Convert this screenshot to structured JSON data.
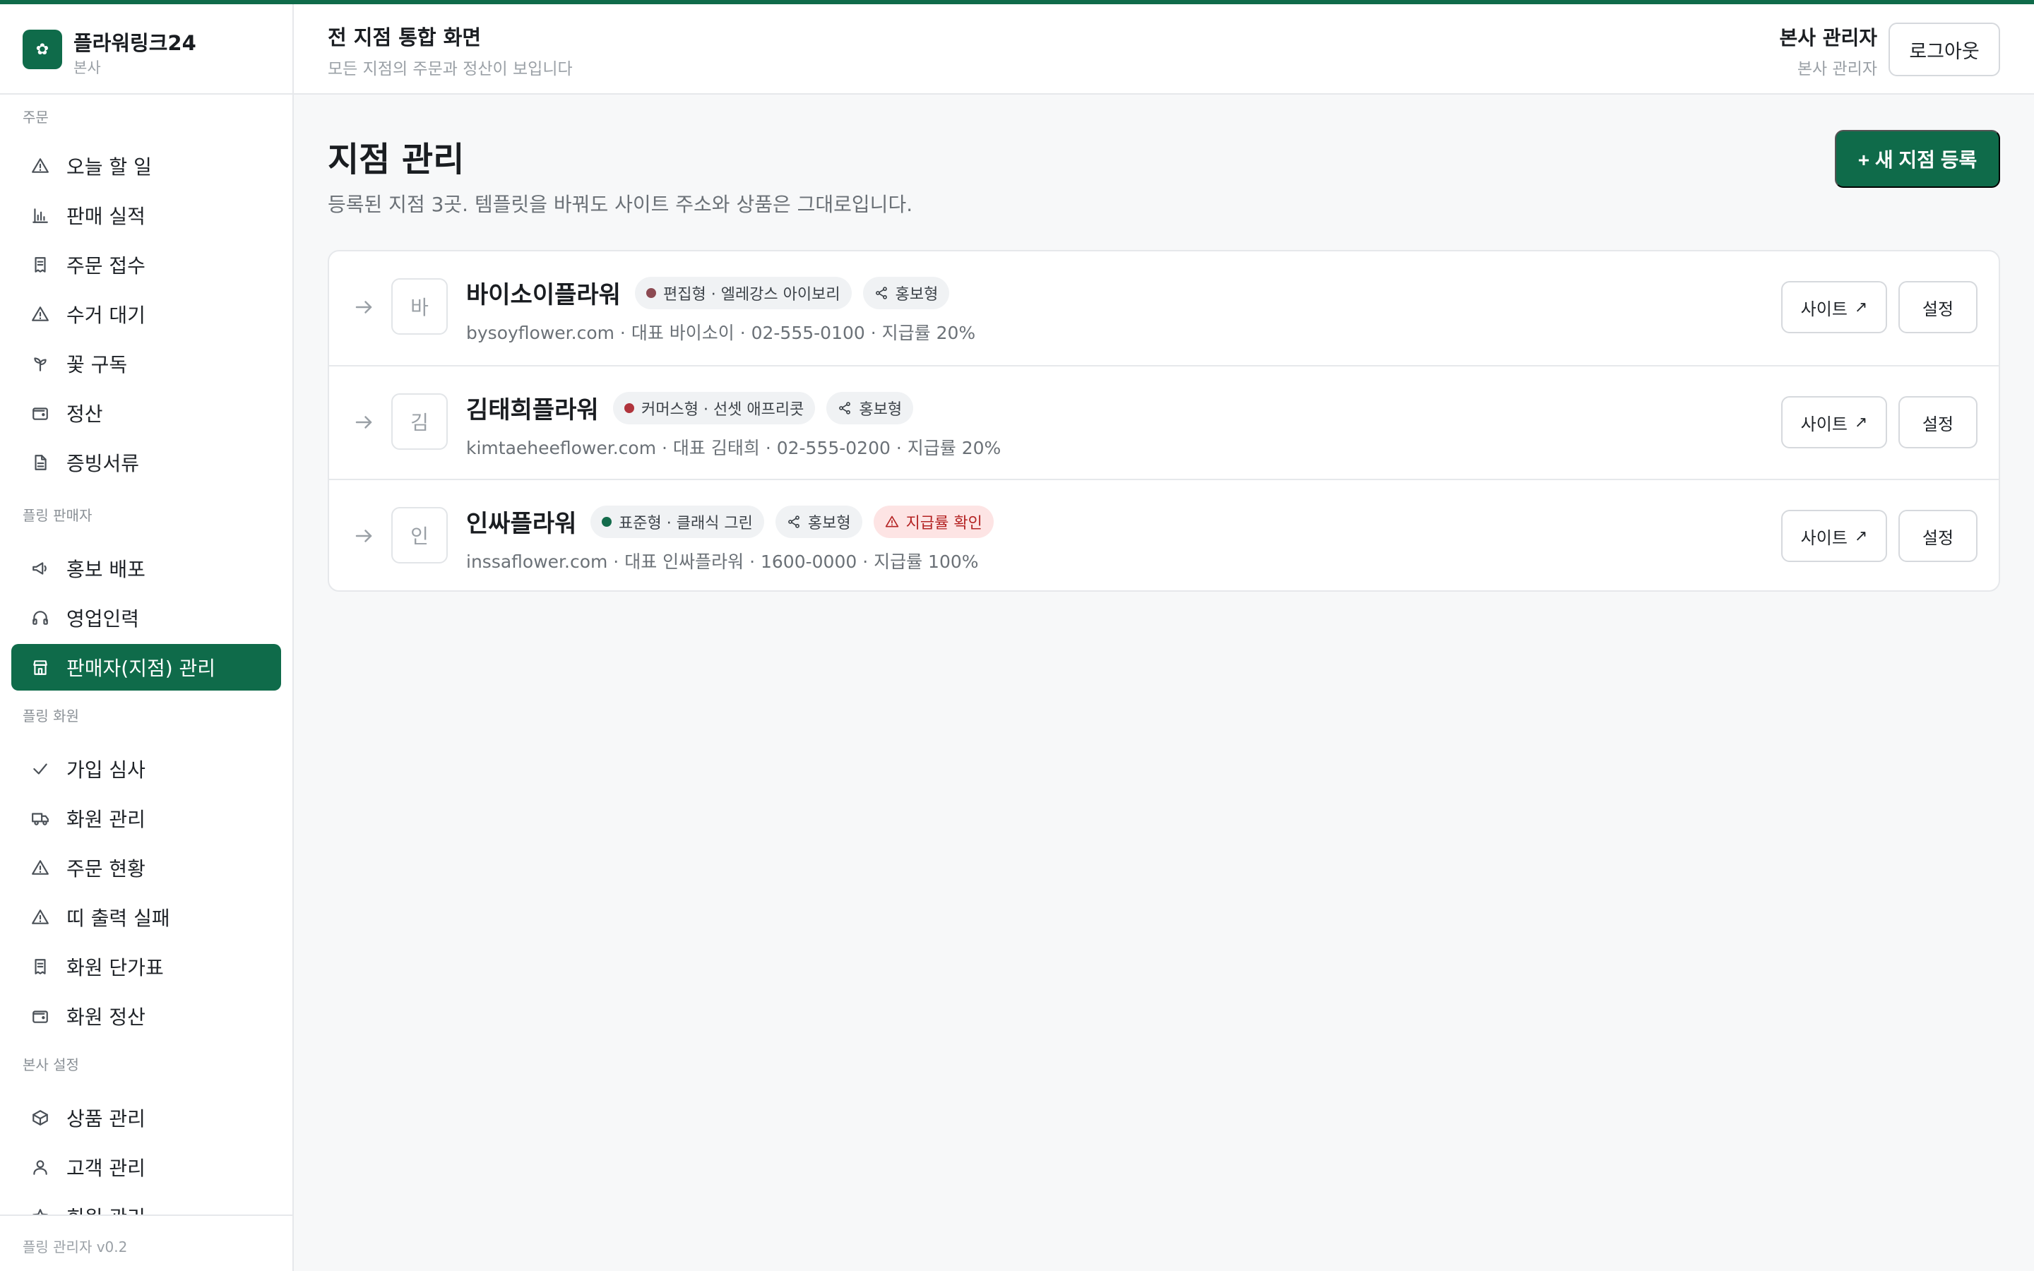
{
  "brand": {
    "name": "플라워링크24",
    "sub": "본사",
    "logo_icon": "flower-icon"
  },
  "header": {
    "title": "전 지점 통합 화면",
    "subtitle": "모든 지점의 주문과 정산이 보입니다",
    "user_name": "본사 관리자",
    "user_role": "본사 관리자",
    "logout_label": "로그아웃"
  },
  "sidebar": {
    "sections": [
      {
        "title": "주문",
        "items": [
          {
            "label": "오늘 할 일",
            "icon": "alert-triangle-icon"
          },
          {
            "label": "판매 실적",
            "icon": "bar-chart-icon"
          },
          {
            "label": "주문 접수",
            "icon": "receipt-icon"
          },
          {
            "label": "수거 대기",
            "icon": "alert-triangle-icon"
          },
          {
            "label": "꽃 구독",
            "icon": "sprout-icon"
          },
          {
            "label": "정산",
            "icon": "wallet-icon"
          },
          {
            "label": "증빙서류",
            "icon": "document-icon"
          }
        ]
      },
      {
        "title": "플링 판매자",
        "items": [
          {
            "label": "홍보 배포",
            "icon": "megaphone-icon"
          },
          {
            "label": "영업인력",
            "icon": "headphones-icon"
          },
          {
            "label": "판매자(지점) 관리",
            "icon": "store-icon",
            "active": true
          }
        ]
      },
      {
        "title": "플링 화원",
        "items": [
          {
            "label": "가입 심사",
            "icon": "check-icon"
          },
          {
            "label": "화원 관리",
            "icon": "truck-icon"
          },
          {
            "label": "주문 현황",
            "icon": "alert-triangle-icon"
          },
          {
            "label": "띠 출력 실패",
            "icon": "alert-triangle-icon"
          },
          {
            "label": "화원 단가표",
            "icon": "receipt-icon"
          },
          {
            "label": "화원 정산",
            "icon": "wallet-icon"
          }
        ]
      },
      {
        "title": "본사 설정",
        "items": [
          {
            "label": "상품 관리",
            "icon": "box-icon"
          },
          {
            "label": "고객 관리",
            "icon": "user-icon"
          },
          {
            "label": "회원 관리",
            "icon": "star-icon"
          }
        ]
      }
    ],
    "footer": "플링 관리자 v0.2"
  },
  "main": {
    "title": "지점 관리",
    "description": "등록된 지점 3곳. 템플릿을 바꿔도 사이트 주소와 상품은 그대로입니다.",
    "new_button": "+ 새 지점 등록",
    "site_button": "사이트",
    "settings_button": "설정",
    "branches": [
      {
        "initial": "바",
        "name": "바이소이플라워",
        "template": "편집형 · 엘레강스 아이보리",
        "template_color": "#8c4a52",
        "promo": "홍보형",
        "warning": null,
        "meta": "bysoyflower.com · 대표 바이소이 · 02-555-0100 · 지급률 20%"
      },
      {
        "initial": "김",
        "name": "김태희플라워",
        "template": "커머스형 · 선셋 애프리콧",
        "template_color": "#b0343c",
        "promo": "홍보형",
        "warning": null,
        "meta": "kimtaeheeflower.com · 대표 김태희 · 02-555-0200 · 지급률 20%"
      },
      {
        "initial": "인",
        "name": "인싸플라워",
        "template": "표준형 · 클래식 그린",
        "template_color": "#146c4c",
        "promo": "홍보형",
        "warning": "지급률 확인",
        "meta": "inssaflower.com · 대표 인싸플라워 · 1600-0000 · 지급률 100%"
      }
    ]
  },
  "colors": {
    "accent": "#0f6b4a",
    "warn_bg": "#fde4e4",
    "warn_text": "#b42323"
  }
}
